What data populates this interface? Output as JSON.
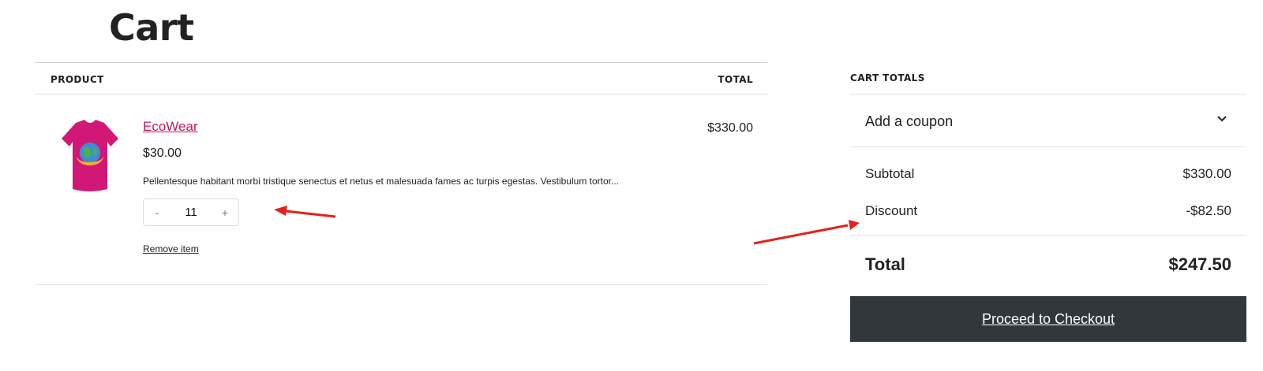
{
  "page": {
    "title": "Cart"
  },
  "table": {
    "header_product": "PRODUCT",
    "header_total": "TOTAL",
    "items": [
      {
        "name": "EcoWear",
        "price": "$30.00",
        "description": "Pellentesque habitant morbi tristique senectus et netus et malesuada fames ac turpis egestas. Vestibulum tortor...",
        "quantity": "11",
        "minus": "-",
        "plus": "+",
        "remove_label": "Remove item",
        "line_total": "$330.00",
        "image_icon": "tshirt-icon",
        "shirt_color": "#d11877"
      }
    ]
  },
  "totals": {
    "heading": "CART TOTALS",
    "coupon_label": "Add a coupon",
    "subtotal_label": "Subtotal",
    "subtotal_value": "$330.00",
    "discount_label": "Discount",
    "discount_value": "-$82.50",
    "total_label": "Total",
    "total_value": "$247.50",
    "checkout_label": "Proceed to Checkout",
    "checkout_bg": "#32373c"
  },
  "annotation_color": "#e3211c"
}
